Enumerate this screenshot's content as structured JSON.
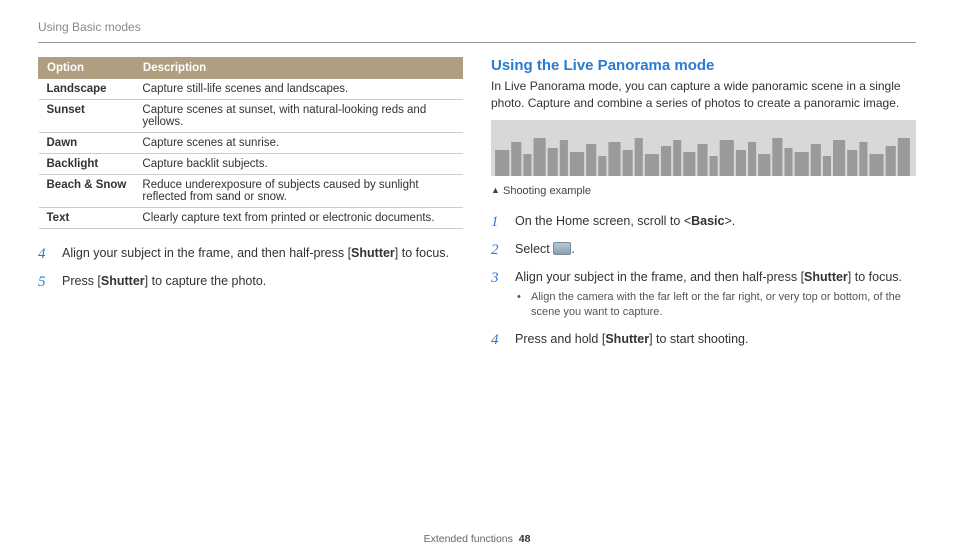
{
  "header": "Using Basic modes",
  "table": {
    "head": {
      "c1": "Option",
      "c2": "Description"
    },
    "rows": [
      {
        "opt": "Landscape",
        "desc": "Capture still-life scenes and landscapes."
      },
      {
        "opt": "Sunset",
        "desc": "Capture scenes at sunset, with natural-looking reds and yellows."
      },
      {
        "opt": "Dawn",
        "desc": "Capture scenes at sunrise."
      },
      {
        "opt": "Backlight",
        "desc": "Capture backlit subjects."
      },
      {
        "opt": "Beach & Snow",
        "desc": "Reduce underexposure of subjects caused by sunlight reflected from sand or snow."
      },
      {
        "opt": "Text",
        "desc": "Clearly capture text from printed or electronic documents."
      }
    ]
  },
  "left_steps": {
    "s4": {
      "num": "4",
      "a": "Align your subject in the frame, and then half-press [",
      "b": "Shutter",
      "c": "] to focus."
    },
    "s5": {
      "num": "5",
      "a": "Press [",
      "b": "Shutter",
      "c": "] to capture the photo."
    }
  },
  "right": {
    "title": "Using the Live Panorama mode",
    "intro": "In Live Panorama mode, you can capture a wide panoramic scene in a single photo. Capture and combine a series of photos to create a panoramic image.",
    "caption": "Shooting example",
    "steps": {
      "s1": {
        "num": "1",
        "a": "On the Home screen, scroll to <",
        "b": "Basic",
        "c": ">."
      },
      "s2": {
        "num": "2",
        "a": "Select ",
        "c": "."
      },
      "s3": {
        "num": "3",
        "a": "Align your subject in the frame, and then half-press [",
        "b": "Shutter",
        "c": "] to focus.",
        "sub": "Align the camera with the far left or the far right, or very top or bottom, of the scene you want to capture."
      },
      "s4": {
        "num": "4",
        "a": "Press and hold [",
        "b": "Shutter",
        "c": "] to start shooting."
      }
    }
  },
  "footer": {
    "section": "Extended functions",
    "page": "48"
  }
}
